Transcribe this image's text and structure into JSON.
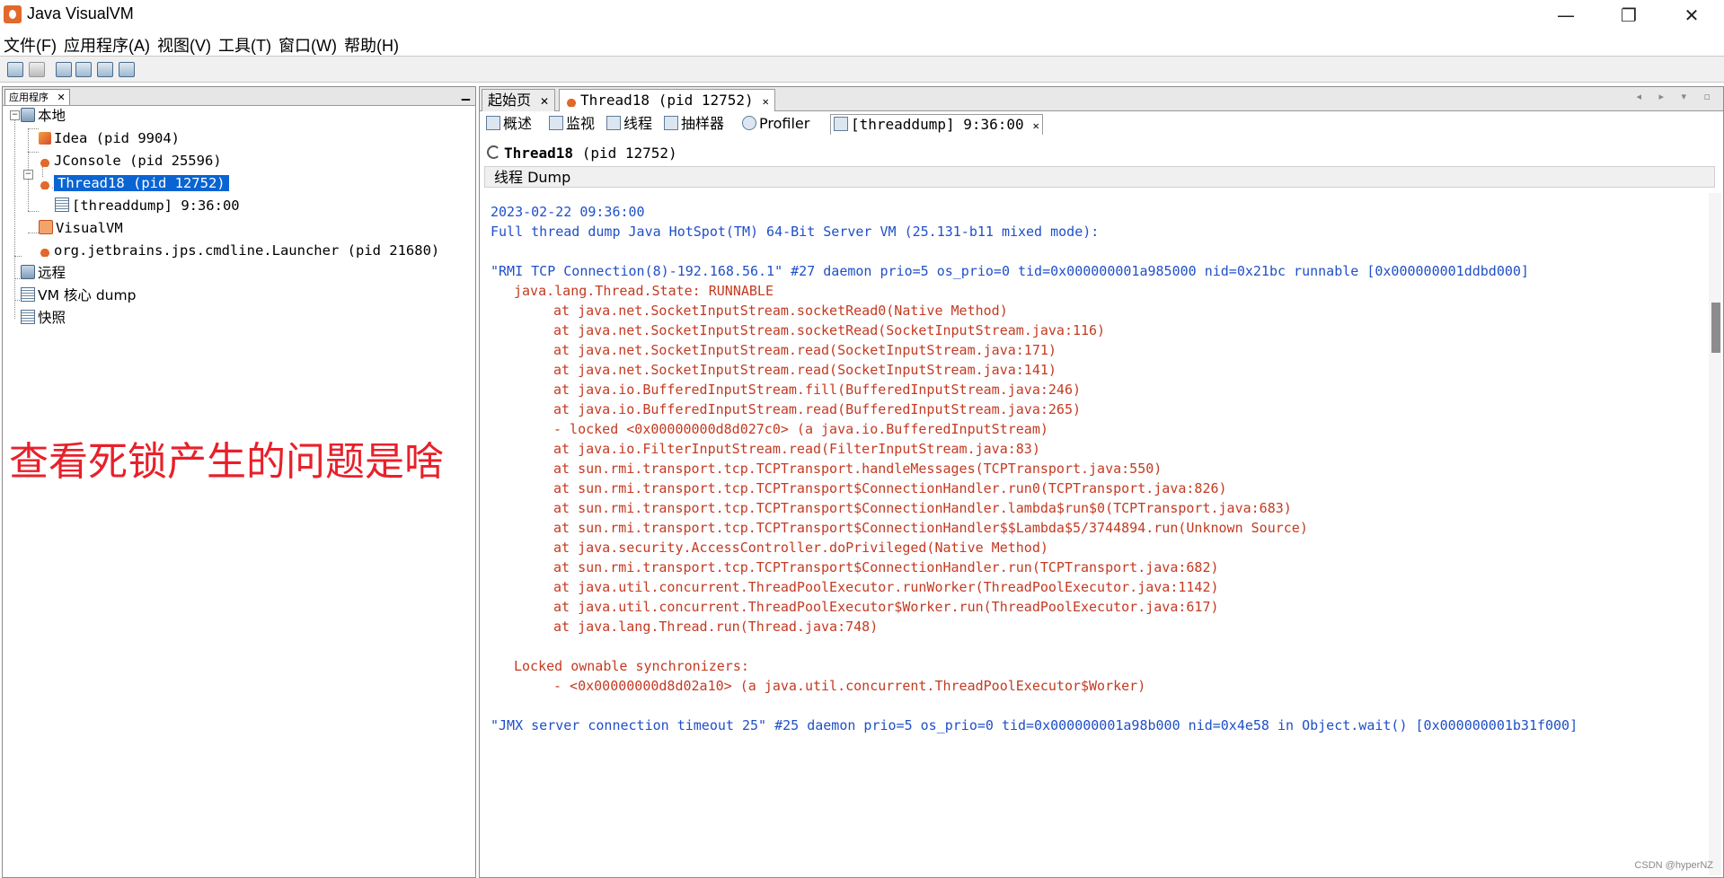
{
  "window": {
    "title": "Java VisualVM",
    "controls": {
      "minimize": "—",
      "maximize": "❐",
      "close": "✕"
    }
  },
  "menubar": [
    "文件(F)",
    "应用程序(A)",
    "视图(V)",
    "工具(T)",
    "窗口(W)",
    "帮助(H)"
  ],
  "left_panel": {
    "tab_label": "应用程序",
    "tab_close": "✕",
    "minimize": "▁",
    "tree": {
      "local": "本地",
      "idea": "Idea (pid 9904)",
      "jconsole": "JConsole (pid 25596)",
      "thread18": "Thread18 (pid 12752)",
      "threaddump": "[threaddump] 9:36:00",
      "visualvm": "VisualVM",
      "launcher": "org.jetbrains.jps.cmdline.Launcher (pid 21680)",
      "remote": "远程",
      "vm_core_dump": "VM 核心 dump",
      "snapshots": "快照"
    }
  },
  "annotation": "查看死锁产生的问题是啥",
  "doc_tabs": [
    {
      "label": "起始页",
      "close": "✕"
    },
    {
      "label": "Thread18 (pid 12752)",
      "close": "✕"
    }
  ],
  "view_tabs": [
    {
      "label": "概述"
    },
    {
      "label": "监视"
    },
    {
      "label": "线程"
    },
    {
      "label": "抽样器"
    },
    {
      "label": "Profiler"
    },
    {
      "label": "[threaddump] 9:36:00",
      "close": "✕"
    }
  ],
  "header": {
    "title": "Thread18",
    "pid": "(pid 12752)"
  },
  "section_title": "线程 Dump",
  "dump": {
    "timestamp": "2023-02-22 09:36:00",
    "vm_line": "Full thread dump Java HotSpot(TM) 64-Bit Server VM (25.131-b11 mixed mode):",
    "thread1_header": "\"RMI TCP Connection(8)-192.168.56.1\" #27 daemon prio=5 os_prio=0 tid=0x000000001a985000 nid=0x21bc runnable [0x000000001ddbd000]",
    "thread1_state": "java.lang.Thread.State: RUNNABLE",
    "frames": [
      "at java.net.SocketInputStream.socketRead0(Native Method)",
      "at java.net.SocketInputStream.socketRead(SocketInputStream.java:116)",
      "at java.net.SocketInputStream.read(SocketInputStream.java:171)",
      "at java.net.SocketInputStream.read(SocketInputStream.java:141)",
      "at java.io.BufferedInputStream.fill(BufferedInputStream.java:246)",
      "at java.io.BufferedInputStream.read(BufferedInputStream.java:265)",
      "- locked <0x00000000d8d027c0> (a java.io.BufferedInputStream)",
      "at java.io.FilterInputStream.read(FilterInputStream.java:83)",
      "at sun.rmi.transport.tcp.TCPTransport.handleMessages(TCPTransport.java:550)",
      "at sun.rmi.transport.tcp.TCPTransport$ConnectionHandler.run0(TCPTransport.java:826)",
      "at sun.rmi.transport.tcp.TCPTransport$ConnectionHandler.lambda$run$0(TCPTransport.java:683)",
      "at sun.rmi.transport.tcp.TCPTransport$ConnectionHandler$$Lambda$5/3744894.run(Unknown Source)",
      "at java.security.AccessController.doPrivileged(Native Method)",
      "at sun.rmi.transport.tcp.TCPTransport$ConnectionHandler.run(TCPTransport.java:682)",
      "at java.util.concurrent.ThreadPoolExecutor.runWorker(ThreadPoolExecutor.java:1142)",
      "at java.util.concurrent.ThreadPoolExecutor$Worker.run(ThreadPoolExecutor.java:617)",
      "at java.lang.Thread.run(Thread.java:748)"
    ],
    "locked_sync_title": "Locked ownable synchronizers:",
    "locked_sync_item": "- <0x00000000d8d02a10> (a java.util.concurrent.ThreadPoolExecutor$Worker)",
    "thread2_header": "\"JMX server connection timeout 25\" #25 daemon prio=5 os_prio=0 tid=0x000000001a98b000 nid=0x4e58 in Object.wait() [0x000000001b31f000]"
  },
  "watermark": "CSDN @hyperNZ"
}
